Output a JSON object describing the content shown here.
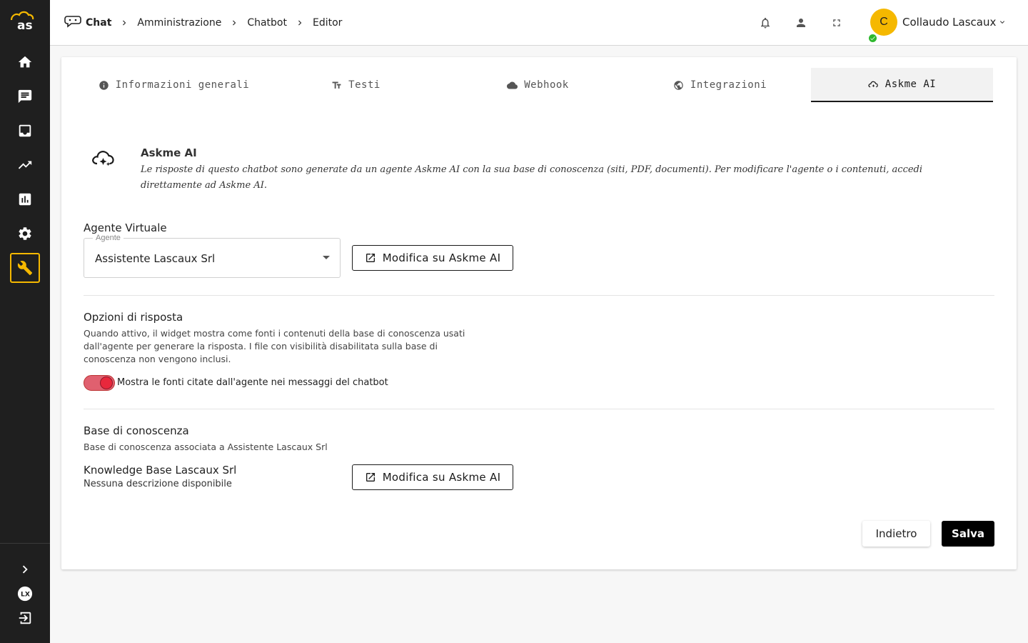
{
  "sidebar": {
    "logo_text": "as",
    "items": [
      {
        "icon": "home-icon"
      },
      {
        "icon": "chat-icon"
      },
      {
        "icon": "inbox-icon"
      },
      {
        "icon": "trending-icon"
      },
      {
        "icon": "bar-chart-icon"
      },
      {
        "icon": "settings-icon"
      },
      {
        "icon": "wrench-icon",
        "active": true
      }
    ],
    "bottom": [
      {
        "icon": "chevron-right-icon"
      },
      {
        "icon": "lx-brand-icon"
      },
      {
        "icon": "logout-icon"
      }
    ],
    "accent_color": "#f5b800"
  },
  "header": {
    "breadcrumb": [
      "Chat",
      "Amministrazione",
      "Chatbot",
      "Editor"
    ],
    "icons": [
      "bell-icon",
      "person-icon",
      "fullscreen-icon"
    ],
    "user": {
      "initial": "C",
      "name": "Collaudo Lascaux",
      "status": "online"
    }
  },
  "tabs": [
    {
      "label": "Informazioni generali",
      "icon": "info-icon",
      "active": false
    },
    {
      "label": "Testi",
      "icon": "text-icon",
      "active": false
    },
    {
      "label": "Webhook",
      "icon": "cloud-icon",
      "active": false
    },
    {
      "label": "Integrazioni",
      "icon": "globe-icon",
      "active": false
    },
    {
      "label": "Askme AI",
      "icon": "askme-cloud-icon",
      "active": true
    }
  ],
  "askme": {
    "title": "Askme AI",
    "description": "Le risposte di questo chatbot sono generate da un agente Askme AI con la sua base di conoscenza (siti, PDF, documenti). Per modificare l'agente o i contenuti, accedi direttamente ad Askme AI."
  },
  "agent": {
    "section_title": "Agente Virtuale",
    "select_label": "Agente",
    "select_value": "Assistente Lascaux Srl",
    "edit_button": "Modifica su Askme AI"
  },
  "response_options": {
    "section_title": "Opzioni di risposta",
    "help": "Quando attivo, il widget mostra come fonti i contenuti della base di conoscenza usati dall'agente per generare la risposta. I file con visibilità disabilitata sulla base di conoscenza non vengono inclusi.",
    "toggle_label": "Mostra le fonti citate dall'agente nei messaggi del chatbot",
    "toggle_on": true,
    "toggle_color": "#e8283c"
  },
  "knowledge_base": {
    "section_title": "Base di conoscenza",
    "help": "Base di conoscenza associata a Assistente Lascaux Srl",
    "name": "Knowledge Base Lascaux Srl",
    "description": "Nessuna descrizione disponibile",
    "edit_button": "Modifica su Askme AI"
  },
  "footer": {
    "back_label": "Indietro",
    "save_label": "Salva"
  }
}
